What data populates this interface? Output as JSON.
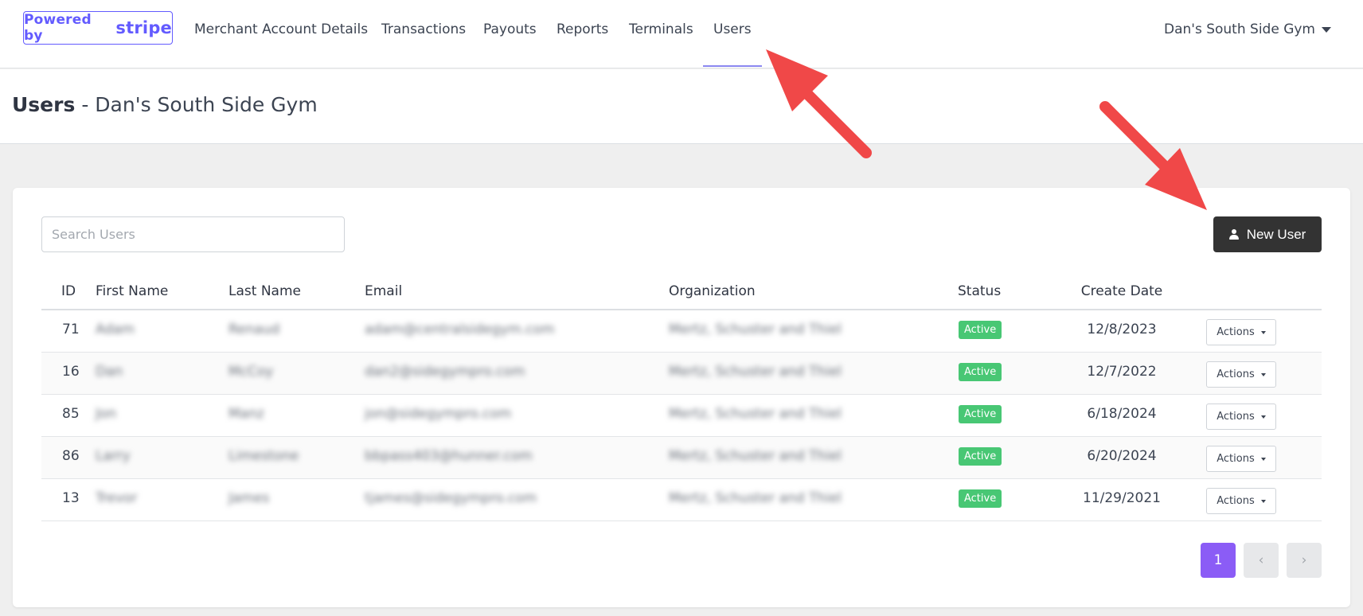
{
  "brand": {
    "prefix": "Powered by",
    "logo": "stripe"
  },
  "nav": {
    "items": [
      {
        "label": "Merchant Account Details"
      },
      {
        "label": "Transactions"
      },
      {
        "label": "Payouts"
      },
      {
        "label": "Reports"
      },
      {
        "label": "Terminals"
      },
      {
        "label": "Users"
      }
    ],
    "active": "Users",
    "account": "Dan's South Side Gym"
  },
  "page": {
    "title": "Users",
    "subtitle": "- Dan's South Side Gym"
  },
  "toolbar": {
    "search_placeholder": "Search Users",
    "new_user_label": "New User"
  },
  "table": {
    "columns": [
      "ID",
      "First Name",
      "Last Name",
      "Email",
      "Organization",
      "Status",
      "Create Date"
    ],
    "rows": [
      {
        "id": "71",
        "first": "Adam",
        "last": "Renaud",
        "email": "adam@centralsidegym.com",
        "org": "Mertz, Schuster and Thiel",
        "status": "Active",
        "date": "12/8/2023",
        "action": "Actions"
      },
      {
        "id": "16",
        "first": "Dan",
        "last": "McCoy",
        "email": "dan2@sidegympro.com",
        "org": "Mertz, Schuster and Thiel",
        "status": "Active",
        "date": "12/7/2022",
        "action": "Actions"
      },
      {
        "id": "85",
        "first": "Jon",
        "last": "Manz",
        "email": "jon@sidegympro.com",
        "org": "Mertz, Schuster and Thiel",
        "status": "Active",
        "date": "6/18/2024",
        "action": "Actions"
      },
      {
        "id": "86",
        "first": "Larry",
        "last": "Limestone",
        "email": "bbpass403@hunner.com",
        "org": "Mertz, Schuster and Thiel",
        "status": "Active",
        "date": "6/20/2024",
        "action": "Actions"
      },
      {
        "id": "13",
        "first": "Trevor",
        "last": "James",
        "email": "tjames@sidegympro.com",
        "org": "Mertz, Schuster and Thiel",
        "status": "Active",
        "date": "11/29/2021",
        "action": "Actions"
      }
    ]
  },
  "pagination": {
    "current": "1",
    "prev_icon": "‹",
    "next_icon": "›"
  },
  "colors": {
    "brand": "#635bff",
    "active_badge": "#48c774",
    "pager_current": "#8b5cf6",
    "annotation_arrow": "#f04848"
  }
}
